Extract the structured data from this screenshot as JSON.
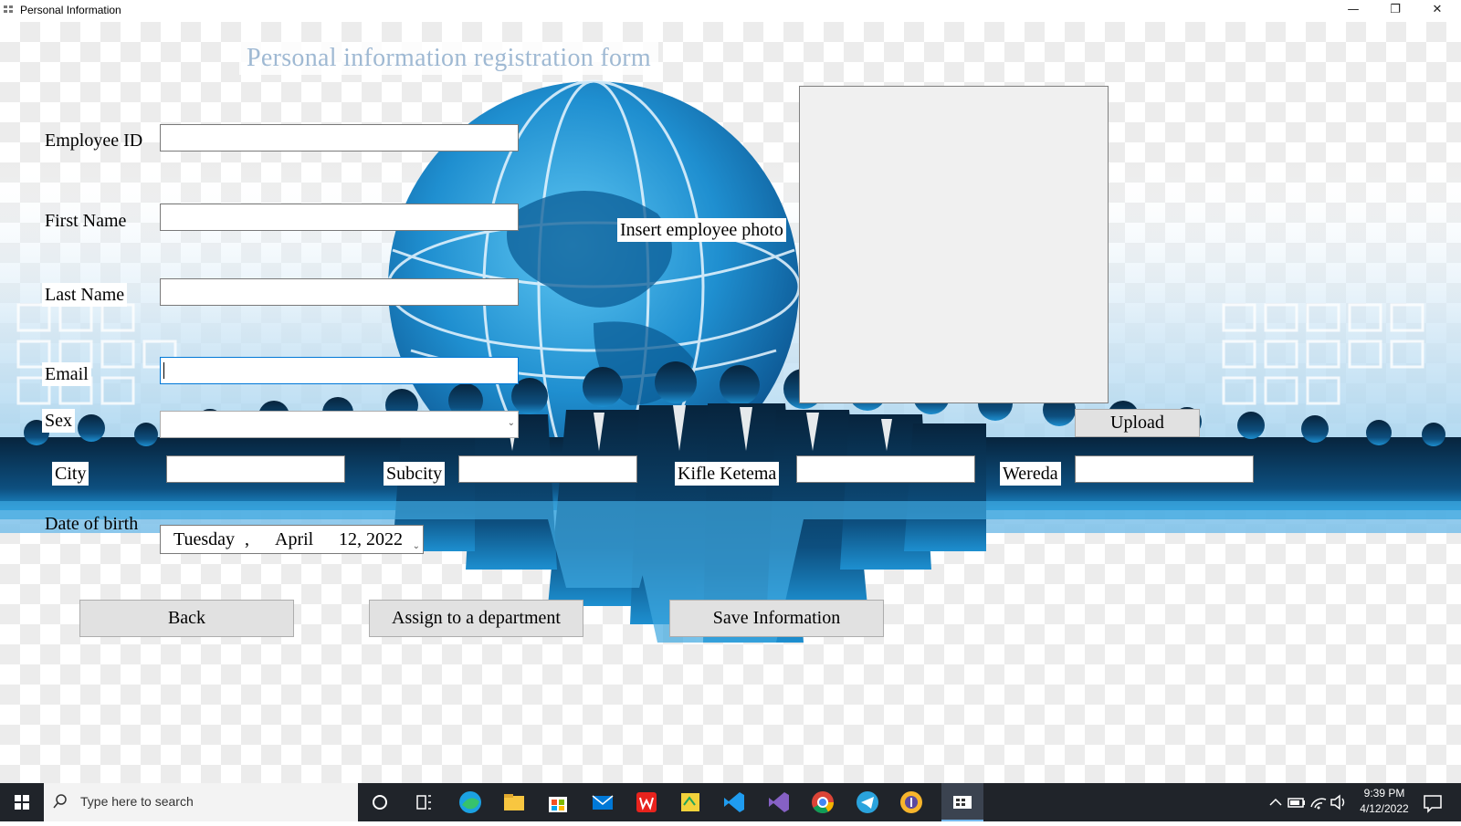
{
  "window": {
    "title": "Personal Information",
    "minimize_glyph": "—",
    "restore_glyph": "❐",
    "close_glyph": "✕"
  },
  "form": {
    "title": "Personal information registration form",
    "labels": {
      "employee_id": "Employee ID",
      "first_name": "First Name",
      "last_name": "Last  Name",
      "email": "Email",
      "sex": "Sex",
      "city": "City",
      "subcity": "Subcity",
      "kifle_ketema": "Kifle Ketema",
      "wereda": "Wereda",
      "date_of_birth": "Date of birth",
      "insert_photo": "Insert employee photo"
    },
    "fields": {
      "employee_id": "",
      "first_name": "",
      "last_name": "",
      "email": "",
      "sex": "",
      "city": "",
      "subcity": "",
      "kifle_ketema": "",
      "wereda": ""
    },
    "date_of_birth": {
      "day_name": "Tuesday",
      "sep": ",",
      "month": "April",
      "day_year": "12, 2022"
    },
    "buttons": {
      "upload": "Upload",
      "back": "Back",
      "assign": "Assign to a department",
      "save": "Save Information"
    }
  },
  "taskbar": {
    "search_placeholder": "Type here to search",
    "time": "9:39 PM",
    "date": "4/12/2022",
    "icons": [
      "windows-start-icon",
      "search-icon",
      "cortana-icon",
      "task-view-icon",
      "edge-icon",
      "file-explorer-icon",
      "microsoft-store-icon",
      "mail-icon",
      "wps-office-icon",
      "sticky-app-icon",
      "vscode-icon",
      "visual-studio-icon",
      "chrome-icon",
      "telegram-icon",
      "brave-icon",
      "running-app-icon",
      "tray-chevron-icon",
      "battery-icon",
      "wifi-icon",
      "volume-icon",
      "notifications-icon"
    ]
  },
  "colors": {
    "title_text": "#9fb9d3",
    "taskbar": "#20242a",
    "globe": "#1f8fd0",
    "crowd": "#0b2a44",
    "textbox_focus": "#0078d7"
  }
}
